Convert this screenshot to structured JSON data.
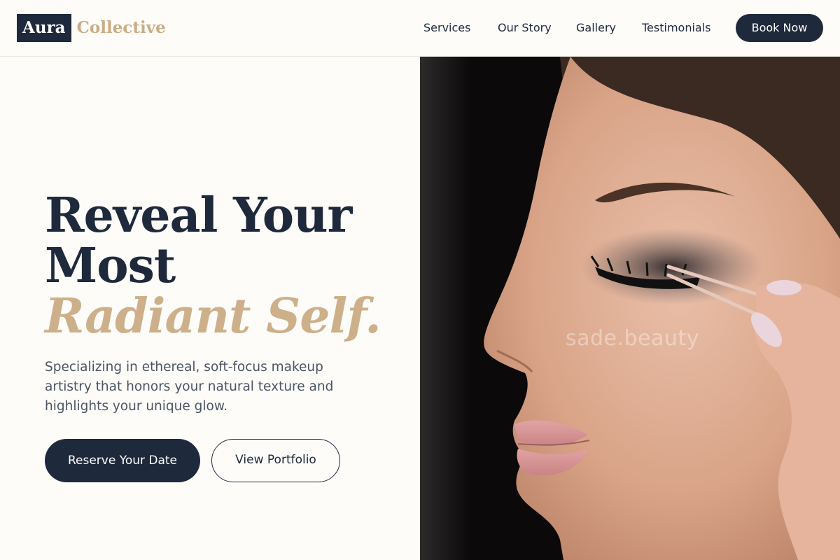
{
  "brand": {
    "mark": "Aura",
    "word": "Collective"
  },
  "nav": {
    "items": [
      {
        "label": "Services"
      },
      {
        "label": "Our Story"
      },
      {
        "label": "Gallery"
      },
      {
        "label": "Testimonials"
      }
    ],
    "cta": "Book Now"
  },
  "hero": {
    "title_line1": "Reveal Your",
    "title_line2": "Most",
    "title_accent": "Radiant Self.",
    "subtitle": "Specializing in ethereal, soft-focus makeup artistry that honors your natural texture and highlights your unique glow.",
    "primary_cta": "Reserve Your Date",
    "secondary_cta": "View Portfolio",
    "image_watermark": "sade.beauty"
  },
  "colors": {
    "navy": "#1e293b",
    "gold": "#c9ad85",
    "background": "#fdfcf9"
  }
}
